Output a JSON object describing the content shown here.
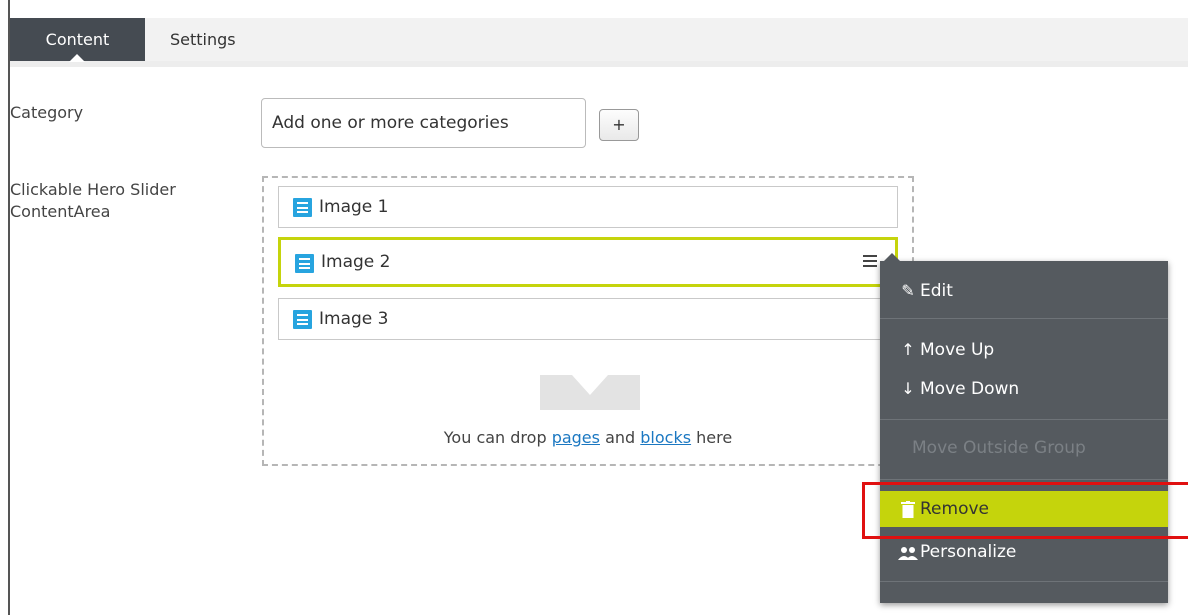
{
  "tabs": [
    {
      "label": "Content",
      "active": true
    },
    {
      "label": "Settings",
      "active": false
    }
  ],
  "fields": {
    "category_label": "Category",
    "category_placeholder": "Add one or more categories",
    "add_button_label": "+",
    "content_area_label": "Clickable Hero Slider ContentArea"
  },
  "content_area": {
    "items": [
      {
        "label": "Image 1"
      },
      {
        "label": "Image 2"
      },
      {
        "label": "Image 3"
      }
    ],
    "drop_text_prefix": "You can drop ",
    "drop_link_pages": "pages",
    "drop_text_and": " and ",
    "drop_link_blocks": "blocks",
    "drop_text_suffix": " here"
  },
  "context_menu": {
    "items": [
      {
        "label": "Edit",
        "icon": "pencil-icon"
      },
      {
        "label": "Move Up",
        "icon": "arrow-up-icon"
      },
      {
        "label": "Move Down",
        "icon": "arrow-down-icon"
      },
      {
        "label": "Move Outside Group",
        "icon": "",
        "disabled": true
      },
      {
        "label": "Remove",
        "icon": "trash-icon",
        "highlighted": true
      },
      {
        "label": "Personalize",
        "icon": "users-icon"
      }
    ]
  },
  "colors": {
    "tab_active_bg": "#454b52",
    "highlight": "#c5d40c",
    "block_icon": "#27a4df",
    "menu_bg": "#555a5f",
    "annotation_red": "#e01010",
    "link": "#1b78c2"
  }
}
